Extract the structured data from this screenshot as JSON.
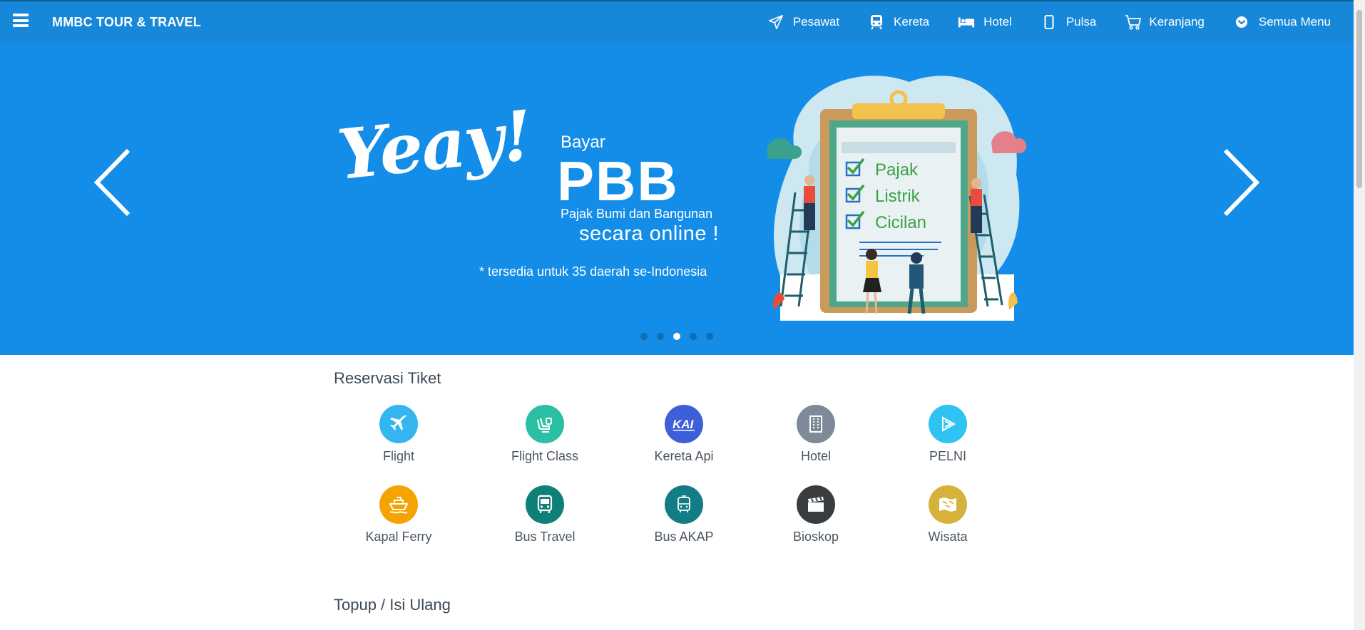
{
  "nav": {
    "brand": "MMBC TOUR & TRAVEL",
    "items": [
      {
        "label": "Pesawat",
        "icon": "paper-plane-icon"
      },
      {
        "label": "Kereta",
        "icon": "train-icon"
      },
      {
        "label": "Hotel",
        "icon": "bed-icon"
      },
      {
        "label": "Pulsa",
        "icon": "mobile-icon"
      },
      {
        "label": "Keranjang",
        "icon": "cart-icon"
      },
      {
        "label": "Semua Menu",
        "icon": "chevron-circle-down-icon"
      }
    ]
  },
  "hero": {
    "yeay": "Yeay!",
    "bayar": "Bayar",
    "headline": "PBB",
    "subline": "Pajak Bumi dan Bangunan",
    "online": "secara online !",
    "note": "* tersedia untuk 35 daerah se-Indonesia",
    "checklist": [
      "Pajak",
      "Listrik",
      "Cicilan"
    ],
    "slides_total": 5,
    "active_slide": 3
  },
  "reservasi": {
    "title": "Reservasi Tiket",
    "items": [
      {
        "label": "Flight",
        "icon": "airplane-icon",
        "color": "#33b5f0"
      },
      {
        "label": "Flight Class",
        "icon": "seat-icon",
        "color": "#2bbfa4"
      },
      {
        "label": "Kereta Api",
        "icon": "kai-logo-icon",
        "color": "#3f5fd8"
      },
      {
        "label": "Hotel",
        "icon": "building-icon",
        "color": "#7e8a97"
      },
      {
        "label": "PELNI",
        "icon": "pelni-logo-icon",
        "color": "#2ec3f2"
      },
      {
        "label": "Kapal Ferry",
        "icon": "ship-icon",
        "color": "#f5a300"
      },
      {
        "label": "Bus Travel",
        "icon": "bus-icon",
        "color": "#0f8077"
      },
      {
        "label": "Bus AKAP",
        "icon": "bus-outline-icon",
        "color": "#127d86"
      },
      {
        "label": "Bioskop",
        "icon": "clapperboard-icon",
        "color": "#3a3d40"
      },
      {
        "label": "Wisata",
        "icon": "map-icon",
        "color": "#d6b23b"
      }
    ]
  },
  "topup": {
    "title": "Topup / Isi Ulang"
  }
}
